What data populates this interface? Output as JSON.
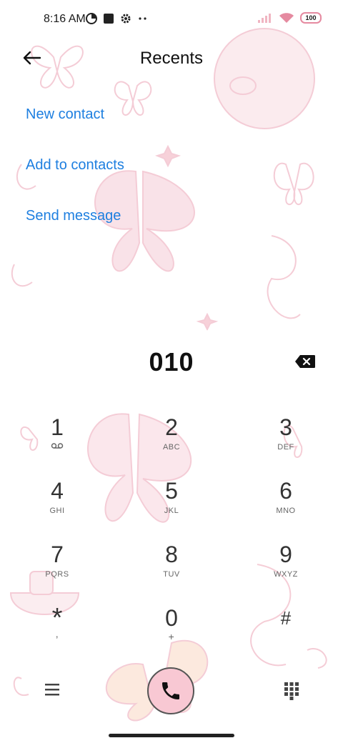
{
  "status_bar": {
    "time": "8:16 AM",
    "battery": "100",
    "icons": [
      "data-saver-icon",
      "square-notification-icon",
      "gear-icon",
      "more-dots-icon",
      "signal-icon",
      "wifi-icon",
      "battery-icon"
    ]
  },
  "header": {
    "title": "Recents",
    "back_icon": "arrow-left-icon"
  },
  "actions": [
    "New contact",
    "Add to contacts",
    "Send message"
  ],
  "dialer": {
    "number": "010",
    "backspace_icon": "backspace-icon",
    "keys": [
      {
        "digit": "1",
        "letters": ""
      },
      {
        "digit": "2",
        "letters": "ABC"
      },
      {
        "digit": "3",
        "letters": "DEF"
      },
      {
        "digit": "4",
        "letters": "GHI"
      },
      {
        "digit": "5",
        "letters": "JKL"
      },
      {
        "digit": "6",
        "letters": "MNO"
      },
      {
        "digit": "7",
        "letters": "PQRS"
      },
      {
        "digit": "8",
        "letters": "TUV"
      },
      {
        "digit": "9",
        "letters": "WXYZ"
      },
      {
        "digit": "*",
        "letters": ","
      },
      {
        "digit": "0",
        "letters": "+"
      },
      {
        "digit": "#",
        "letters": ""
      }
    ]
  },
  "bottom_bar": {
    "menu_icon": "menu-icon",
    "call_icon": "phone-icon",
    "dialpad_icon": "dialpad-icon"
  },
  "colors": {
    "accent": "#1e7fe0",
    "call_button": "#f8c8d3",
    "wallpaper_tint": "#f6c9d3"
  }
}
